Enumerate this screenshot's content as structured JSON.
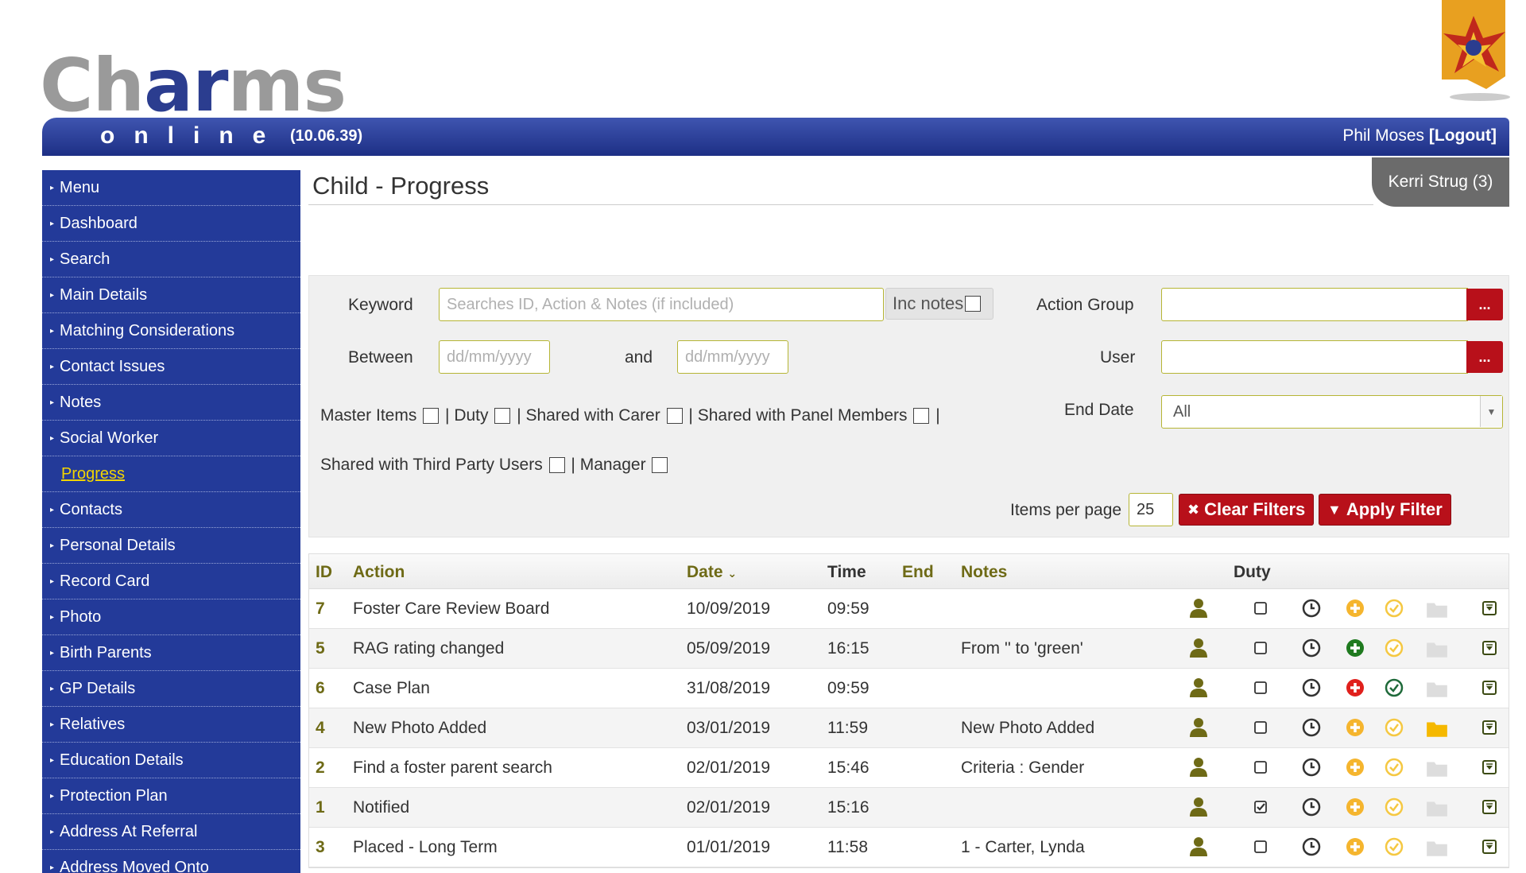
{
  "header": {
    "logo_part1": "Ch",
    "logo_part2": "ar",
    "logo_part3": "ms",
    "logo_online": "online",
    "version": "(10.06.39)",
    "user_name": "Phil Moses",
    "logout_label": "[Logout]"
  },
  "sidebar": {
    "items": [
      {
        "label": "Menu"
      },
      {
        "label": "Dashboard"
      },
      {
        "label": "Search"
      },
      {
        "label": "Main Details"
      },
      {
        "label": "Matching Considerations"
      },
      {
        "label": "Contact Issues"
      },
      {
        "label": "Notes"
      },
      {
        "label": "Social Worker"
      },
      {
        "label": "Progress"
      },
      {
        "label": "Contacts"
      },
      {
        "label": "Personal Details"
      },
      {
        "label": "Record Card"
      },
      {
        "label": "Photo"
      },
      {
        "label": "Birth Parents"
      },
      {
        "label": "GP Details"
      },
      {
        "label": "Relatives"
      },
      {
        "label": "Education Details"
      },
      {
        "label": "Protection Plan"
      },
      {
        "label": "Address At Referral"
      },
      {
        "label": "Address Moved Onto"
      }
    ]
  },
  "page": {
    "title": "Child - Progress",
    "child_tab": "Kerri Strug (3)"
  },
  "filter": {
    "keyword_label": "Keyword",
    "keyword_placeholder": "Searches ID, Action & Notes (if included)",
    "inc_notes_label": "Inc notes",
    "between_label": "Between",
    "date_placeholder": "dd/mm/yyyy",
    "and_label": "and",
    "action_group_label": "Action Group",
    "user_label": "User",
    "lookup_label": "...",
    "end_date_label": "End Date",
    "end_date_value": "All",
    "master_items_label": "Master Items",
    "duty_label": "| Duty",
    "shared_carer_label": "| Shared with Carer",
    "shared_panel_label": "| Shared with Panel Members",
    "separator": "|",
    "shared_third_party_label": "Shared with Third Party Users",
    "manager_label": "| Manager",
    "items_per_page_label": "Items per page",
    "items_per_page_value": "25",
    "clear_filters_label": "Clear Filters",
    "apply_filter_label": "Apply Filter"
  },
  "table": {
    "columns": {
      "id": "ID",
      "action": "Action",
      "date": "Date",
      "time": "Time",
      "end": "End",
      "notes": "Notes",
      "duty": "Duty"
    },
    "rows": [
      {
        "id": "7",
        "action": "Foster Care Review Board",
        "date": "10/09/2019",
        "time": "09:59",
        "notes": "",
        "duty": false,
        "add_color": "#f5b52e",
        "check_color": "#f5c842",
        "folder_color": "#dddddd"
      },
      {
        "id": "5",
        "action": "RAG rating changed",
        "date": "05/09/2019",
        "time": "16:15",
        "notes": "From '' to 'green'",
        "duty": false,
        "add_color": "#1f7a1f",
        "check_color": "#f5c842",
        "folder_color": "#dddddd"
      },
      {
        "id": "6",
        "action": "Case Plan",
        "date": "31/08/2019",
        "time": "09:59",
        "notes": "",
        "duty": false,
        "add_color": "#e0201c",
        "check_color": "#1f6a3a",
        "folder_color": "#dddddd"
      },
      {
        "id": "4",
        "action": "New Photo Added",
        "date": "03/01/2019",
        "time": "11:59",
        "notes": "New Photo Added",
        "duty": false,
        "add_color": "#f5b52e",
        "check_color": "#f5c842",
        "folder_color": "#f5b800"
      },
      {
        "id": "2",
        "action": "Find a foster parent search",
        "date": "02/01/2019",
        "time": "15:46",
        "notes": "Criteria : Gender",
        "duty": false,
        "add_color": "#f5b52e",
        "check_color": "#f5c842",
        "folder_color": "#dddddd"
      },
      {
        "id": "1",
        "action": "Notified",
        "date": "02/01/2019",
        "time": "15:16",
        "notes": "",
        "duty": true,
        "add_color": "#f5b52e",
        "check_color": "#f5c842",
        "folder_color": "#dddddd"
      },
      {
        "id": "3",
        "action": "Placed - Long Term",
        "date": "01/01/2019",
        "time": "11:58",
        "notes": "1 - Carter, Lynda",
        "duty": false,
        "add_color": "#f5b52e",
        "check_color": "#f5c842",
        "folder_color": "#dddddd"
      }
    ]
  },
  "colors": {
    "brand_blue": "#233a99",
    "accent_olive": "#6e6a16",
    "button_red": "#b8101a",
    "active_nav": "#f2d400"
  }
}
